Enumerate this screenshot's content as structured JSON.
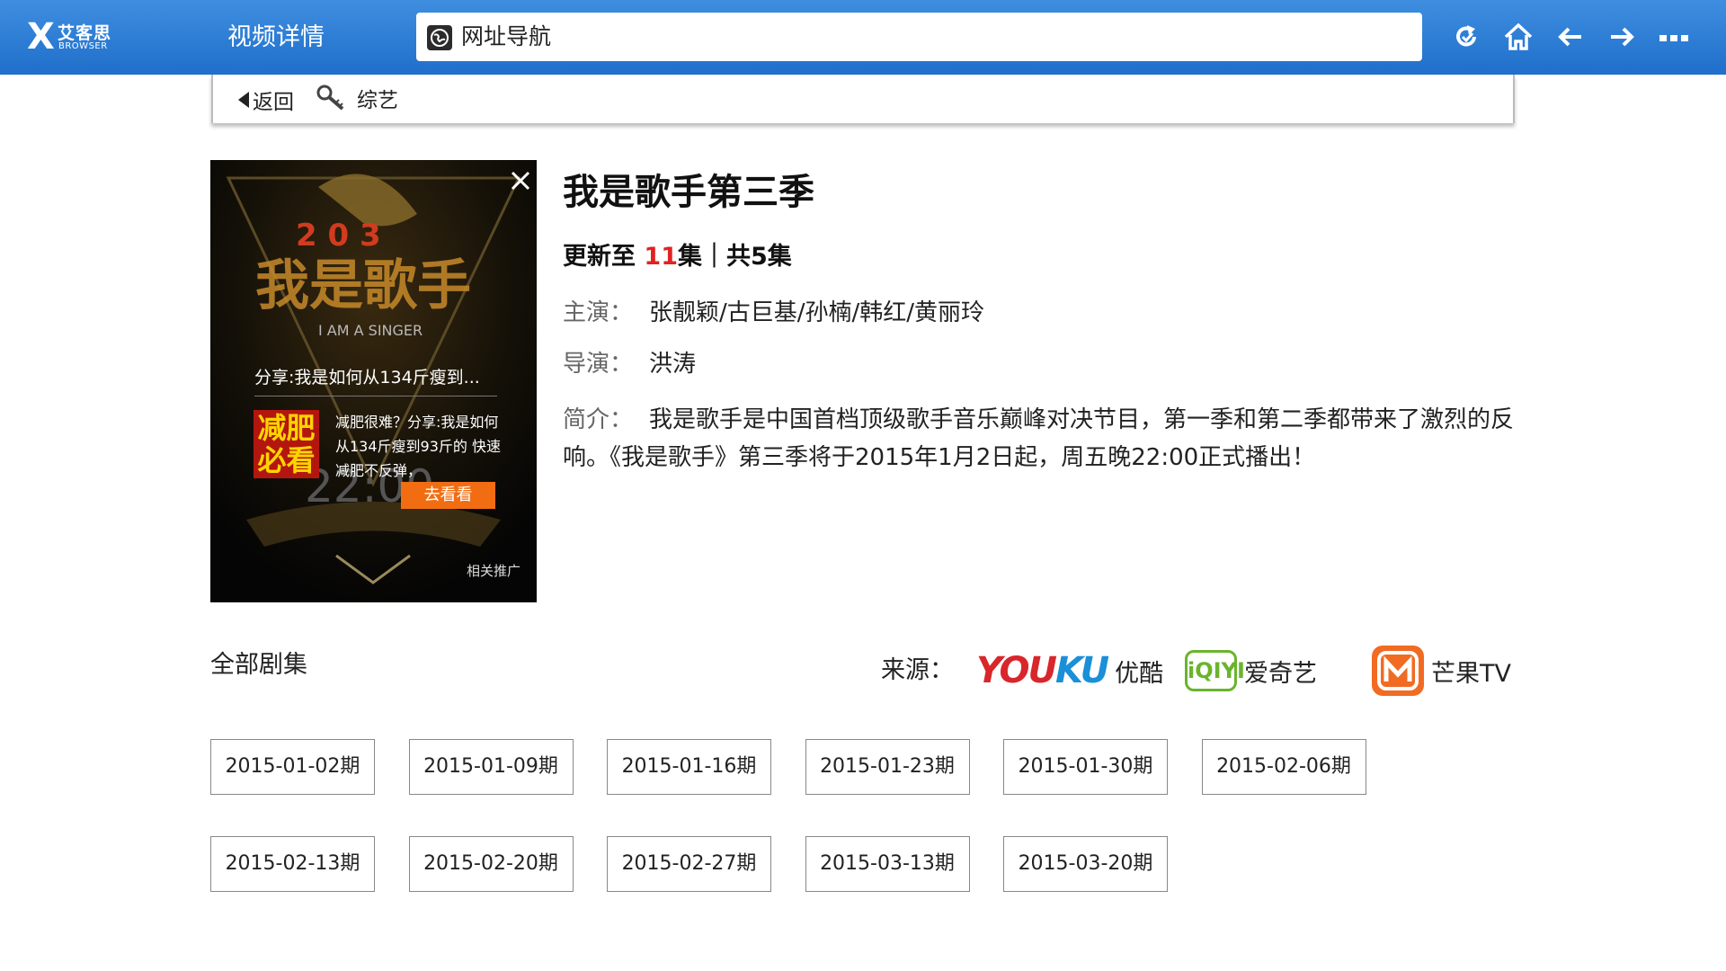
{
  "app": {
    "logo_x": "X",
    "logo_cn": "艾客思",
    "logo_en": "BROWSER"
  },
  "header": {
    "title": "视频详情",
    "url_text": "网址导航"
  },
  "toolbar_icons": [
    "refresh-icon",
    "home-icon",
    "back-arrow-icon",
    "forward-arrow-icon",
    "more-icon"
  ],
  "subnav": {
    "back_label": "返回",
    "category": "综艺"
  },
  "ad": {
    "title": "分享:我是如何从134斤瘦到...",
    "badge_line1": "减肥",
    "badge_line2": "必看",
    "desc": "减肥很难？分享:我是如何从134斤瘦到93斤的 快速减肥不反弹，",
    "button": "去看看",
    "promo": "相关推广"
  },
  "show": {
    "title": "我是歌手第三季",
    "update_prefix": "更新至",
    "update_episode": "11",
    "update_suffix": "集｜共5集",
    "cast_label": "主演：",
    "cast": "张靓颖/古巨基/孙楠/韩红/黄丽玲",
    "director_label": "导演：",
    "director": "洪涛",
    "intro_label": "简介：",
    "intro": "我是歌手是中国首档顶级歌手音乐巅峰对决节目，第一季和第二季都带来了激烈的反响。《我是歌手》第三季将于2015年1月2日起，周五晚22:00正式播出！"
  },
  "episodes": {
    "label": "全部剧集",
    "source_label": "来源：",
    "sources": [
      {
        "logo": "youku",
        "logo_text": "YOUKU",
        "name": "优酷"
      },
      {
        "logo": "iqiyi",
        "logo_text": "iQIYI",
        "name": "爱奇艺"
      },
      {
        "logo": "mgtv",
        "name": "芒果TV"
      }
    ],
    "items": [
      "2015-01-02期",
      "2015-01-09期",
      "2015-01-16期",
      "2015-01-23期",
      "2015-01-30期",
      "2015-02-06期",
      "2015-02-13期",
      "2015-02-20期",
      "2015-02-27期",
      "2015-03-13期",
      "2015-03-20期"
    ]
  },
  "colors": {
    "topbar": "#2a7fd6",
    "accent_red": "#e02222",
    "ad_button": "#f26d12",
    "youku_red": "#d8262b",
    "youku_blue": "#1b8fd8",
    "iqiyi_green": "#6ab42d",
    "mgtv_orange": "#f26b22"
  }
}
